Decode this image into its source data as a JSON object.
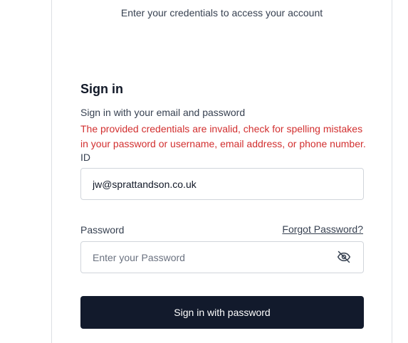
{
  "header": {
    "subtitle": "Enter your credentials to access your account"
  },
  "signin": {
    "title": "Sign in",
    "description": "Sign in with your email and password",
    "error": "The provided credentials are invalid, check for spelling mistakes in your password or username, email address, or phone number."
  },
  "fields": {
    "id": {
      "label": "ID",
      "value": "jw@sprattandson.co.uk"
    },
    "password": {
      "label": "Password",
      "placeholder": "Enter your Password",
      "value": "",
      "toggle_icon": "eye-off-icon"
    }
  },
  "links": {
    "forgot_password": "Forgot Password?"
  },
  "buttons": {
    "submit": "Sign in with password"
  },
  "colors": {
    "error": "#d22f2f",
    "button_bg": "#121a2c",
    "button_text": "#ffffff"
  }
}
